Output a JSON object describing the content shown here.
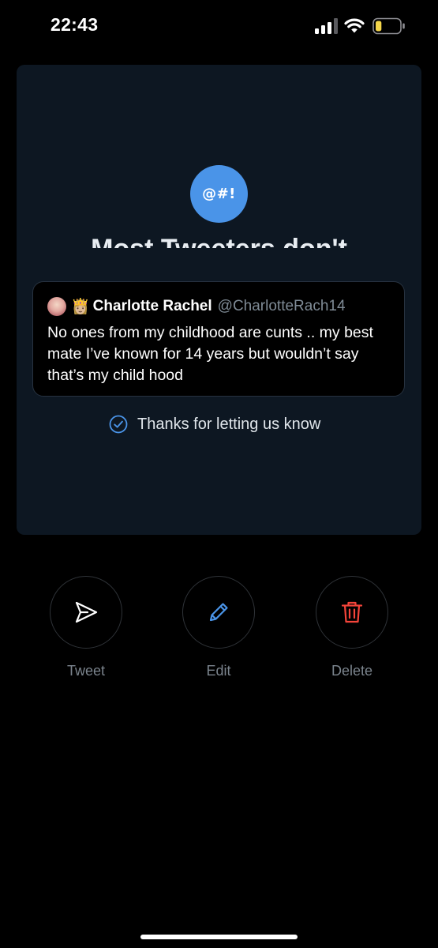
{
  "status_bar": {
    "time": "22:43",
    "signal_icon": "cellular-signal-icon",
    "wifi_icon": "wifi-icon",
    "battery_icon": "battery-low-icon",
    "battery_level": 0.25,
    "battery_color": "#f5d64a"
  },
  "card": {
    "badge_text": "@#!",
    "badge_color": "#4a94e8",
    "heading": "Most Tweeters don't",
    "tweet": {
      "avatar": "profile-photo",
      "emoji": "👸🏼",
      "author_name": "Charlotte Rachel",
      "author_handle": "@CharlotteRach14",
      "text": "No ones from my childhood are cunts .. my best mate I’ve known for 14 years but wouldn’t say that’s my child hood"
    },
    "confirmation": {
      "icon": "check-circle-icon",
      "text": "Thanks for letting us know",
      "accent": "#4a94e8"
    }
  },
  "actions": [
    {
      "label": "Tweet",
      "icon": "send-icon",
      "color": "#ffffff"
    },
    {
      "label": "Edit",
      "icon": "pencil-icon",
      "color": "#4a94e8"
    },
    {
      "label": "Delete",
      "icon": "trash-icon",
      "color": "#f4443a"
    }
  ]
}
